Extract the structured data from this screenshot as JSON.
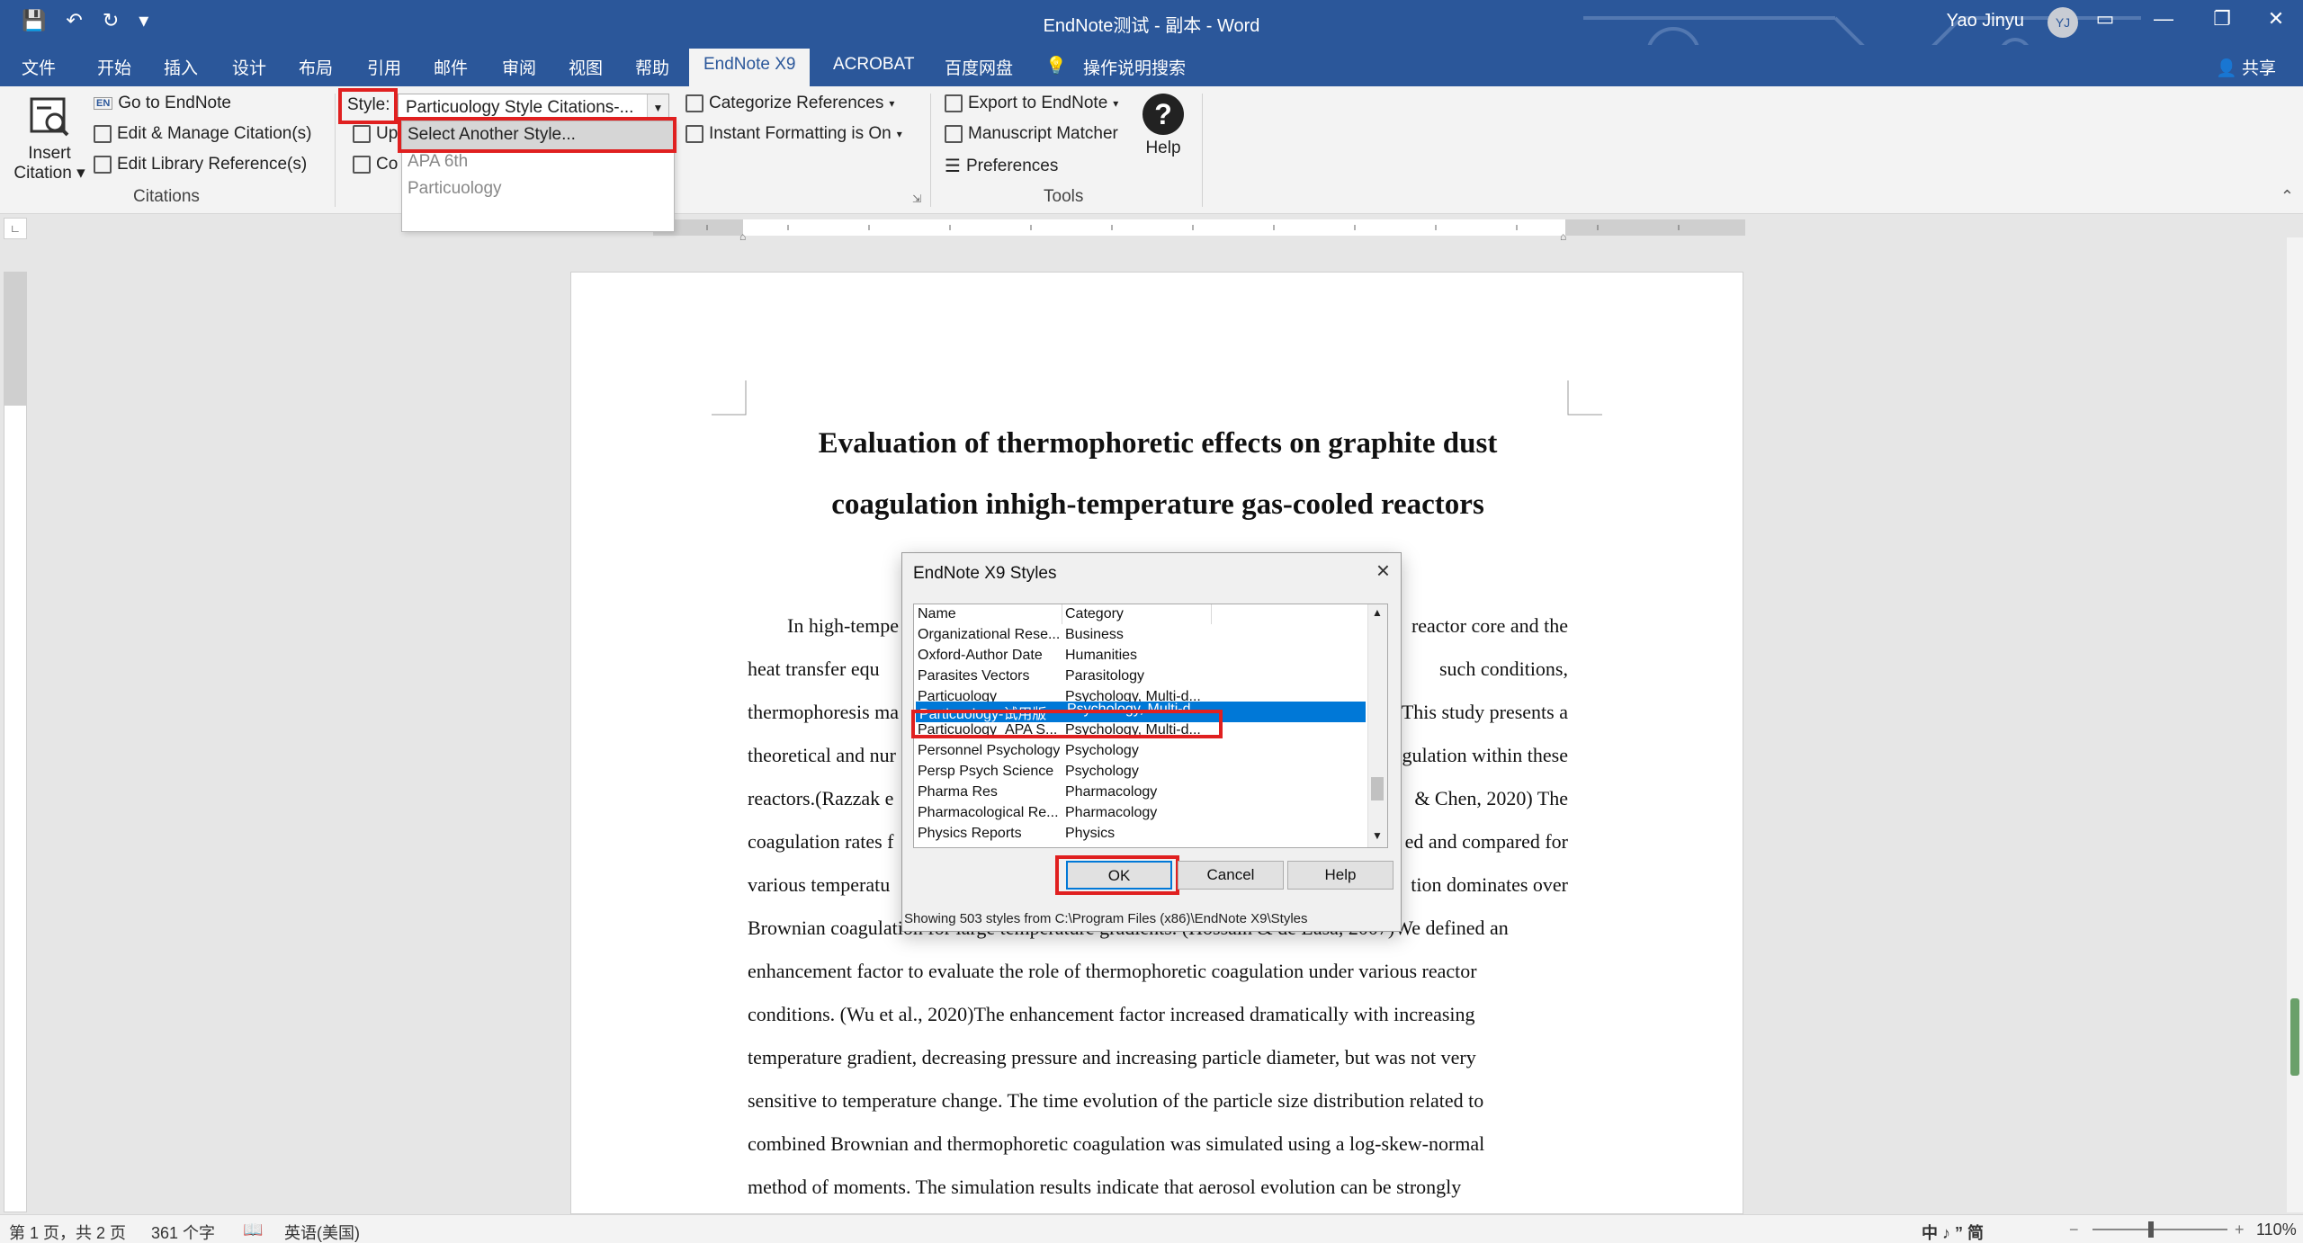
{
  "titlebar": {
    "title": "EndNote测试 - 副本  -  Word",
    "user": "Yao Jinyu",
    "avatar_initials": "YJ",
    "accent": "#2b579a"
  },
  "tabs": [
    {
      "label": "文件"
    },
    {
      "label": "开始"
    },
    {
      "label": "插入"
    },
    {
      "label": "设计"
    },
    {
      "label": "布局"
    },
    {
      "label": "引用"
    },
    {
      "label": "邮件"
    },
    {
      "label": "审阅"
    },
    {
      "label": "视图"
    },
    {
      "label": "帮助"
    },
    {
      "label": "EndNote X9",
      "active": true
    },
    {
      "label": "ACROBAT"
    },
    {
      "label": "百度网盘"
    },
    {
      "label": "操作说明搜索"
    }
  ],
  "share_label": "共享",
  "ribbon": {
    "insert_citation": "Insert\nCitation",
    "insert_citation_line1": "Insert",
    "insert_citation_line2": "Citation",
    "go_to_endnote": "Go to EndNote",
    "edit_manage": "Edit & Manage Citation(s)",
    "edit_library": "Edit Library Reference(s)",
    "citations_group": "Citations",
    "style_label": "Style:",
    "style_value": "Particuology Style Citations-...",
    "update_partial": "Up",
    "convert_partial": "Co",
    "categorize": "Categorize References",
    "instant_formatting": "Instant Formatting is On",
    "export_endnote": "Export to EndNote",
    "manuscript_matcher": "Manuscript Matcher",
    "preferences": "Preferences",
    "help": "Help",
    "tools_group": "Tools"
  },
  "style_dropdown": {
    "options": [
      "Select Another Style...",
      "APA 6th",
      "Particuology"
    ]
  },
  "document": {
    "title_line1": "Evaluation of thermophoretic effects on graphite dust",
    "title_line2": "coagulation inhigh-temperature gas-cooled reactors",
    "lines": [
      [
        "In high-tempe",
        "reactor core and the"
      ],
      [
        "heat  transfer  equ",
        "such  conditions,"
      ],
      [
        "thermophoresis ma",
        "This study presents a"
      ],
      [
        "theoretical and nur",
        "gulation within these"
      ],
      [
        "reactors.(Razzak  e",
        "&  Chen,  2020)  The"
      ],
      [
        "coagulation rates f",
        "ed and compared for"
      ],
      [
        "various temperatu",
        "tion dominates over"
      ],
      [
        "Brownian  coagulation  for  large  temperature  gradients.  (Hossain  &  de  Lasa,  2007)We  defined  an",
        ""
      ],
      [
        "enhancement  factor  to  evaluate  the  role  of  thermophoretic  coagulation  under  various  reactor",
        ""
      ],
      [
        "conditions.  (Wu  et  al.,  2020)The  enhancement  factor  increased  dramatically  with  increasing",
        ""
      ],
      [
        "temperature  gradient,  decreasing  pressure  and  increasing  particle  diameter,  but  was  not  very",
        ""
      ],
      [
        "sensitive  to  temperature  change.  The  time  evolution  of  the  particle  size  distribution  related  to",
        ""
      ],
      [
        "combined  Brownian  and  thermophoretic  coagulation  was  simulated  using  a  log-skew-normal",
        ""
      ],
      [
        "method  of  moments.  The  simulation  results  indicate  that  aerosol  evolution  can  be  strongly",
        ""
      ]
    ]
  },
  "dialog": {
    "title": "EndNote X9 Styles",
    "col_name": "Name",
    "col_category": "Category",
    "rows": [
      {
        "name": "Organizational Rese...",
        "category": "Business"
      },
      {
        "name": "Oxford-Author Date",
        "category": "Humanities"
      },
      {
        "name": "Parasites Vectors",
        "category": "Parasitology"
      },
      {
        "name": "Particuology",
        "category": "Psychology, Multi-d..."
      },
      {
        "name": "Particuology-试用版",
        "category": "Psychology, Multi-d...",
        "selected": true
      },
      {
        "name": "Particuology_APA S...",
        "category": "Psychology, Multi-d..."
      },
      {
        "name": "Personnel Psychology",
        "category": "Psychology"
      },
      {
        "name": "Persp Psych Science",
        "category": "Psychology"
      },
      {
        "name": "Pharma Res",
        "category": "Pharmacology"
      },
      {
        "name": "Pharmacological Re...",
        "category": "Pharmacology"
      },
      {
        "name": "Physics Reports",
        "category": "Physics"
      }
    ],
    "ok": "OK",
    "cancel": "Cancel",
    "help": "Help",
    "status": "Showing 503 styles from C:\\Program Files (x86)\\EndNote X9\\Styles",
    "selection_color": "#0078d7"
  },
  "statusbar": {
    "page": "第 1 页，共 2 页",
    "words": "361 个字",
    "language": "英语(美国)",
    "ime": "中 ♪ ” 简",
    "zoom": "110%"
  },
  "highlight_color": "#e02020"
}
